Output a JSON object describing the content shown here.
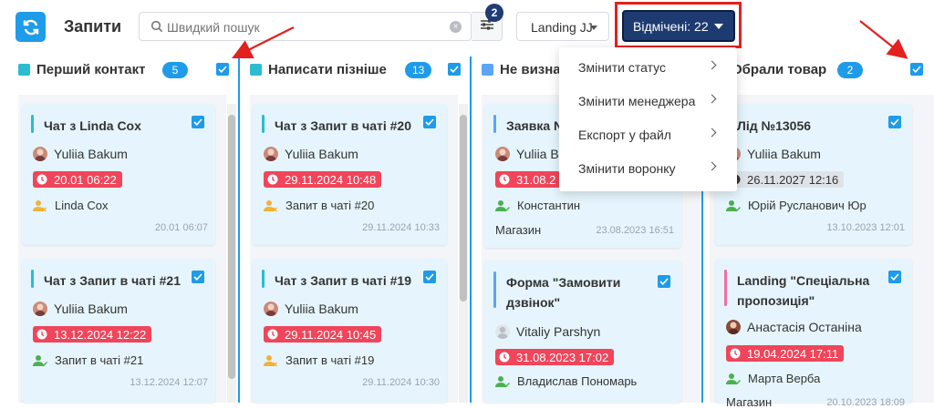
{
  "header": {
    "title": "Запити",
    "search_placeholder": "Швидкий пошук",
    "filter_count": "2",
    "funnel_label": "Landing JJ",
    "cancelled_label": "Відмічені: 22"
  },
  "menu": {
    "items": [
      {
        "label": "Змінити статус"
      },
      {
        "label": "Змінити менеджера"
      },
      {
        "label": "Експорт у файл"
      },
      {
        "label": "Змінити воронку"
      }
    ]
  },
  "columns": [
    {
      "title": "Перший контакт",
      "count": "5",
      "color": "#2bbccf",
      "cards": [
        {
          "title": "Чат з Linda Cox",
          "user": "Yuliia Bakum",
          "date": "20.01 06:22",
          "contact": "Linda Cox",
          "ts": "20.01 06:07"
        },
        {
          "title": "Чат з Запит в чаті #21",
          "user": "Yuliia Bakum",
          "date": "13.12.2024 12:22",
          "contact": "Запит в чаті #21",
          "ts": "13.12.2024 12:07"
        }
      ]
    },
    {
      "title": "Написати пізніше",
      "count": "13",
      "color": "#2bbccf",
      "cards": [
        {
          "title": "Чат з Запит в чаті #20",
          "user": "Yuliia Bakum",
          "date": "29.11.2024 10:48",
          "contact": "Запит в чаті #20",
          "ts": "29.11.2024 10:33"
        },
        {
          "title": "Чат з Запит в чаті #19",
          "user": "Yuliia Bakum",
          "date": "29.11.2024 10:45",
          "contact": "Запит в чаті #19",
          "ts": "29.11.2024 10:30"
        }
      ]
    },
    {
      "title": "Не визна",
      "color": "#5aa5f5",
      "cards": [
        {
          "title": "Заявка N",
          "user": "Yuliia Bak",
          "date": "31.08.2",
          "contact": "Константин",
          "misc": "Магазин",
          "ts": "23.08.2023 16:51"
        },
        {
          "title_line1": "Форма \"Замовити",
          "title_line2": "дзвінок\"",
          "user": "Vitaliy Parshyn",
          "date": "31.08.2023 17:02",
          "contact": "Владислав Пономарь"
        }
      ]
    },
    {
      "title": "Обрали товар",
      "count": "2",
      "color": "#2bbccf",
      "cards": [
        {
          "title": "Лід №13056",
          "user": "Yuliia Bakum",
          "date": "26.11.2027 12:16",
          "contact": "Юрій Русланович Юр",
          "ts": "13.10.2023 12:01"
        },
        {
          "title_line1": "Landing \"Спеціальна",
          "title_line2": "пропозиція\"",
          "user": "Анастасія Останіна",
          "date": "19.04.2024 17:11",
          "contact": "Марта Верба",
          "misc": "Магазин",
          "ts": "20.10.2023 18:09"
        }
      ]
    }
  ],
  "colors": {
    "accent": "#1e9be9",
    "dark_button": "#1d3b70",
    "overdue": "#f0455a",
    "annotation": "#e3211f"
  },
  "icons": [
    "refresh-icon",
    "search-icon",
    "clear-icon",
    "filter-sliders-icon",
    "chevron-down-icon",
    "checkbox-checked-icon",
    "clock-icon",
    "contact-person-icon",
    "avatar-icon",
    "chevron-right-icon",
    "red-arrow-annotation"
  ]
}
